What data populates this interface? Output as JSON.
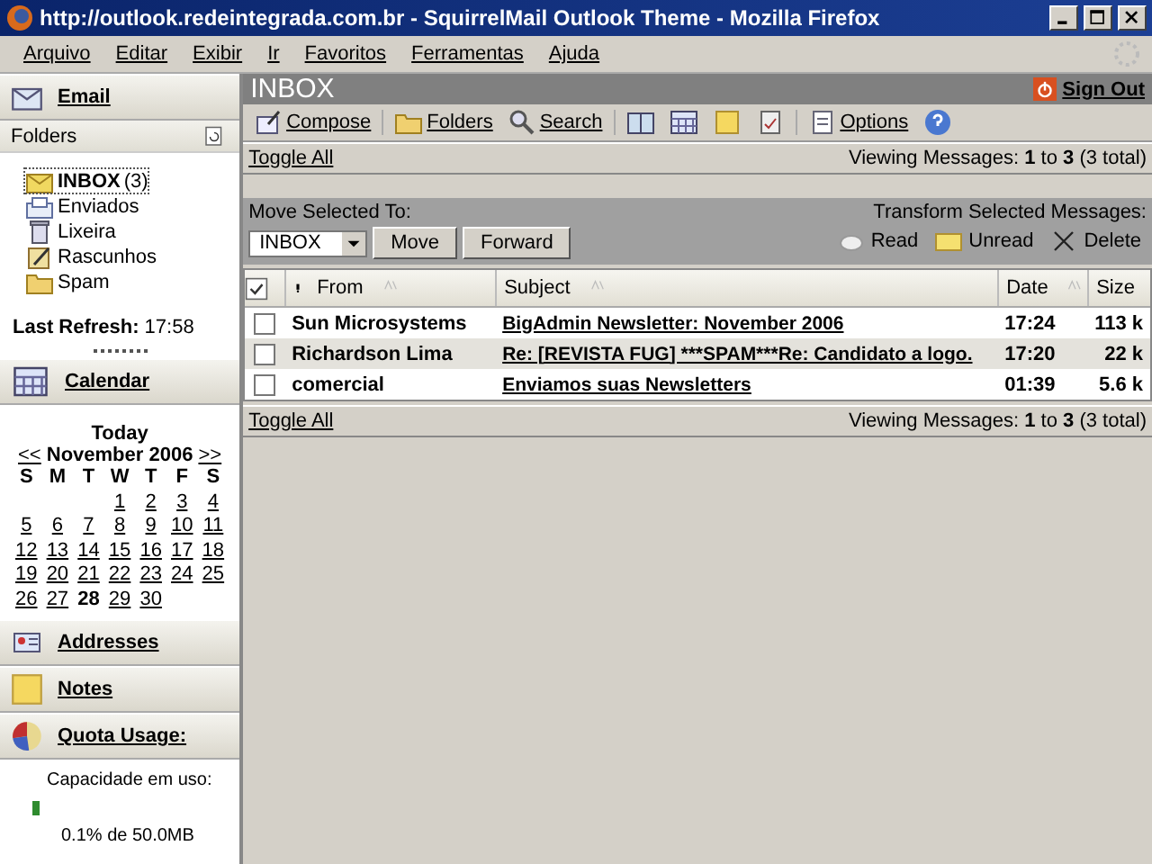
{
  "window": {
    "title": "http://outlook.redeintegrada.com.br - SquirrelMail Outlook Theme - Mozilla Firefox"
  },
  "menu": [
    "Arquivo",
    "Editar",
    "Exibir",
    "Ir",
    "Favoritos",
    "Ferramentas",
    "Ajuda"
  ],
  "sidebar": {
    "email_title": "Email",
    "folders_title": "Folders",
    "folders": [
      {
        "name": "INBOX",
        "count": "(3)",
        "selected": true,
        "kind": "inbox"
      },
      {
        "name": "Enviados",
        "selected": false,
        "kind": "sent"
      },
      {
        "name": "Lixeira",
        "selected": false,
        "kind": "trash"
      },
      {
        "name": "Rascunhos",
        "selected": false,
        "kind": "drafts"
      },
      {
        "name": "Spam",
        "selected": false,
        "kind": "folder"
      }
    ],
    "last_refresh_label": "Last Refresh:",
    "last_refresh": "17:58",
    "calendar": {
      "title": "Calendar",
      "today": "Today",
      "prev": "<<",
      "month": "November 2006",
      "next": ">>",
      "weekdays": [
        "S",
        "M",
        "T",
        "W",
        "T",
        "F",
        "S"
      ],
      "weeks": [
        {
          "kind": "end",
          "days": [
            {
              "day": "1",
              "today": false
            },
            {
              "day": "2",
              "today": false
            },
            {
              "day": "3",
              "today": false
            },
            {
              "day": "4",
              "today": false
            }
          ]
        },
        {
          "kind": "start",
          "days": [
            {
              "day": "5",
              "today": false
            },
            {
              "day": "6",
              "today": false
            },
            {
              "day": "7",
              "today": false
            },
            {
              "day": "8",
              "today": false
            },
            {
              "day": "9",
              "today": false
            },
            {
              "day": "10",
              "today": false
            },
            {
              "day": "11",
              "today": false
            }
          ]
        },
        {
          "kind": "start",
          "days": [
            {
              "day": "12",
              "today": false
            },
            {
              "day": "13",
              "today": false
            },
            {
              "day": "14",
              "today": false
            },
            {
              "day": "15",
              "today": false
            },
            {
              "day": "16",
              "today": false
            },
            {
              "day": "17",
              "today": false
            },
            {
              "day": "18",
              "today": false
            }
          ]
        },
        {
          "kind": "start",
          "days": [
            {
              "day": "19",
              "today": false
            },
            {
              "day": "20",
              "today": false
            },
            {
              "day": "21",
              "today": false
            },
            {
              "day": "22",
              "today": false
            },
            {
              "day": "23",
              "today": false
            },
            {
              "day": "24",
              "today": false
            },
            {
              "day": "25",
              "today": false
            }
          ]
        },
        {
          "kind": "start",
          "days": [
            {
              "day": "26",
              "today": false
            },
            {
              "day": "27",
              "today": false
            },
            {
              "day": "28",
              "today": true
            },
            {
              "day": "29",
              "today": false
            },
            {
              "day": "30",
              "today": false
            }
          ]
        }
      ]
    },
    "addresses_title": "Addresses",
    "notes_title": "Notes",
    "quota": {
      "title": "Quota Usage:",
      "label": "Capacidade em uso:",
      "reading": "0.1% de 50.0MB"
    }
  },
  "main": {
    "title": "INBOX",
    "sign_out": "Sign Out",
    "toolbar": [
      {
        "kind": "compose",
        "label": "Compose"
      },
      {
        "kind": "folders",
        "label": "Folders"
      },
      {
        "kind": "search",
        "label": "Search"
      },
      {
        "kind": "addressbook"
      },
      {
        "kind": "calendar"
      },
      {
        "kind": "notes"
      },
      {
        "kind": "tasks"
      },
      {
        "kind": "options",
        "label": "Options"
      },
      {
        "kind": "help"
      }
    ],
    "toggle_all": "Toggle All",
    "viewing": {
      "prefix": "Viewing Messages:",
      "from": "1",
      "to_word": "to",
      "to": "3",
      "total": "(3 total)"
    },
    "move_label": "Move Selected To:",
    "move_target": "INBOX",
    "move_button": "Move",
    "forward_button": "Forward",
    "transform_label": "Transform Selected Messages:",
    "transform": [
      {
        "kind": "read",
        "label": "Read"
      },
      {
        "kind": "unread",
        "label": "Unread"
      },
      {
        "kind": "delete",
        "label": "Delete"
      }
    ],
    "columns": [
      {
        "label": "From",
        "sortable": true
      },
      {
        "label": "Subject",
        "sortable": true
      },
      {
        "label": "Date",
        "sortable": true
      },
      {
        "label": "Size",
        "sortable": false
      }
    ],
    "messages": [
      {
        "from": "Sun Microsystems",
        "subject": "BigAdmin Newsletter: November 2006",
        "date": "17:24",
        "size": "113 k",
        "checked": false
      },
      {
        "from": "Richardson Lima",
        "subject": "Re: [REVISTA FUG] ***SPAM***Re: Candidato a logo.",
        "date": "17:20",
        "size": "22 k",
        "checked": false
      },
      {
        "from": "comercial",
        "subject": "Enviamos suas Newsletters",
        "date": "01:39",
        "size": "5.6 k",
        "checked": false
      }
    ],
    "footer_toggle_all": "Toggle All",
    "footer_viewing": {
      "prefix": "Viewing Messages:",
      "from": "1",
      "to_word": "to",
      "to": "3",
      "total": "(3 total)"
    }
  }
}
